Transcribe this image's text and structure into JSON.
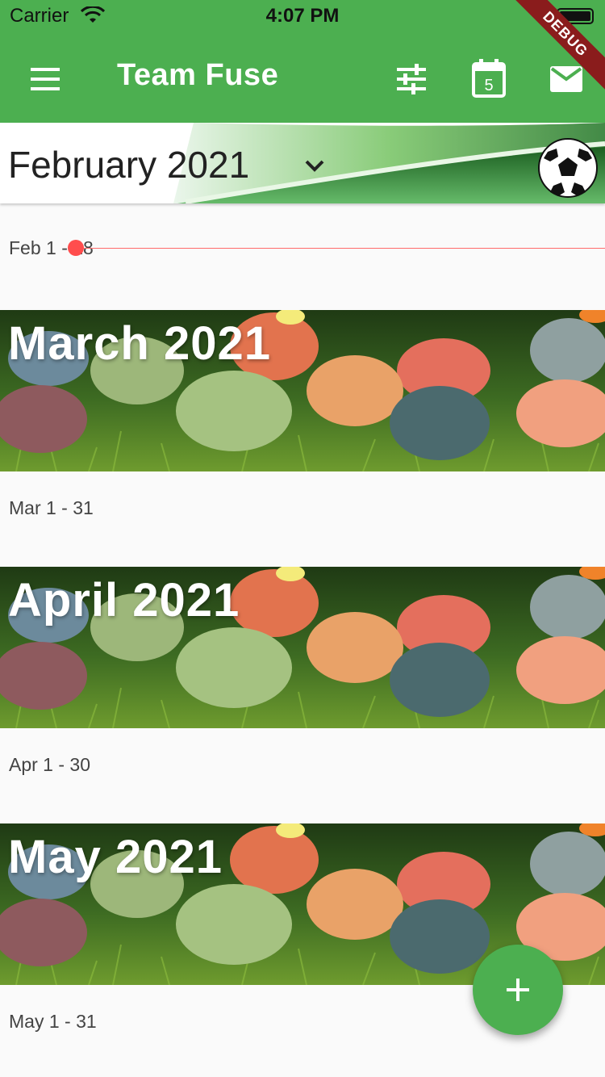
{
  "status_bar": {
    "carrier": "Carrier",
    "time": "4:07 PM"
  },
  "app_bar": {
    "title": "Team Fuse",
    "calendar_day": "5",
    "debug_label": "DEBUG"
  },
  "current_month": {
    "title": "February 2021",
    "range": "Feb 1 - 28"
  },
  "months": [
    {
      "title": "March 2021",
      "range": "Mar 1 - 31"
    },
    {
      "title": "April 2021",
      "range": "Apr 1 - 30"
    },
    {
      "title": "May 2021",
      "range": "May 1 - 31"
    }
  ],
  "colors": {
    "primary": "#4caf50",
    "now_indicator": "#ff4d4d"
  },
  "icons": [
    "menu-icon",
    "tune-icon",
    "calendar-icon",
    "mail-icon",
    "chevron-down-icon",
    "soccer-ball-icon",
    "add-icon"
  ]
}
